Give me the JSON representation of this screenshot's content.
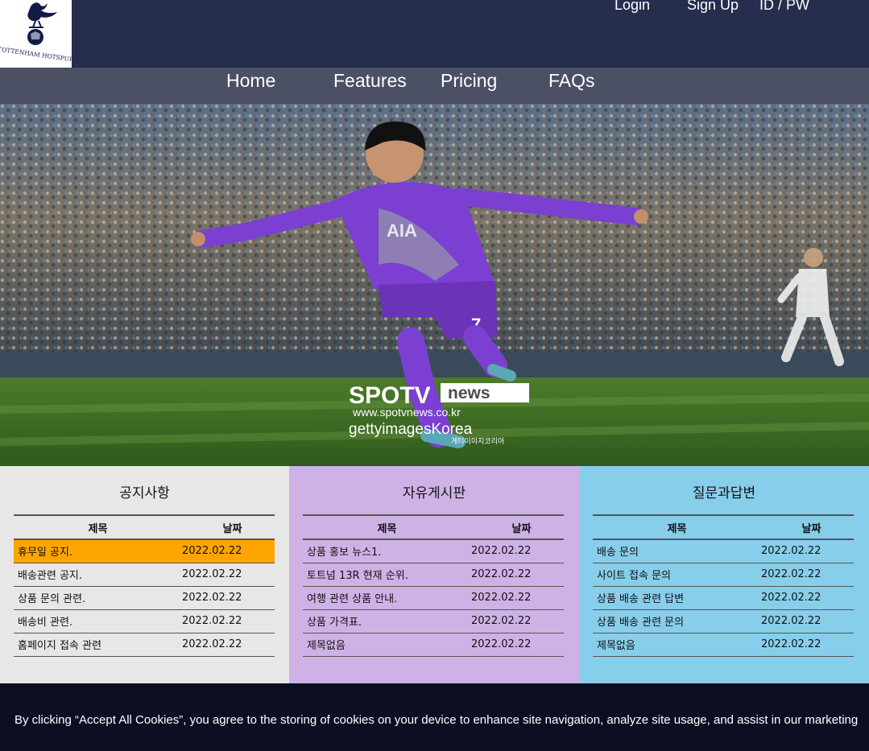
{
  "header": {
    "logo_text": "TOTTENHAM HOTSPUR",
    "auth_links": [
      "Login",
      "Sign Up",
      "ID / PW"
    ]
  },
  "nav": {
    "items": [
      "Home",
      "Features",
      "Pricing",
      "FAQs"
    ]
  },
  "hero": {
    "watermark_brand": "SPOTV",
    "watermark_badge": "news",
    "watermark_url": "www.spotvnews.co.kr",
    "watermark_getty": "gettyimagesKorea",
    "watermark_getty_kr": "게티이미지코리아",
    "shirt_sponsor": "AIA",
    "shirt_number": "7"
  },
  "boards": [
    {
      "title": "공지사항",
      "col_title": "제목",
      "col_date": "날짜",
      "rows": [
        {
          "title": "휴무일 공지.",
          "date": "2022.02.22",
          "highlight": true
        },
        {
          "title": "배송관련 공지.",
          "date": "2022.02.22"
        },
        {
          "title": "상품 문의 관련.",
          "date": "2022.02.22"
        },
        {
          "title": "배송비 관련.",
          "date": "2022.02.22"
        },
        {
          "title": "홈페이지 접속 관련",
          "date": "2022.02.22"
        }
      ]
    },
    {
      "title": "자유게시판",
      "col_title": "제목",
      "col_date": "날짜",
      "rows": [
        {
          "title": "상품 홍보 뉴스1.",
          "date": "2022.02.22"
        },
        {
          "title": "토트넘 13R 현재 순위.",
          "date": "2022.02.22"
        },
        {
          "title": "여행 관련 상품 안내.",
          "date": "2022.02.22"
        },
        {
          "title": "상품 가격표.",
          "date": "2022.02.22"
        },
        {
          "title": "제목없음",
          "date": "2022.02.22"
        }
      ]
    },
    {
      "title": "질문과답변",
      "col_title": "제목",
      "col_date": "날짜",
      "rows": [
        {
          "title": "배송 문의",
          "date": "2022.02.22"
        },
        {
          "title": "사이트 접속 문의",
          "date": "2022.02.22"
        },
        {
          "title": "상품 배송 관련 답변",
          "date": "2022.02.22"
        },
        {
          "title": "상품 배송 관련 문의",
          "date": "2022.02.22"
        },
        {
          "title": "제목없음",
          "date": "2022.02.22"
        }
      ]
    }
  ],
  "cookie": {
    "text": "By clicking “Accept All Cookies”, you agree to the storing of cookies on your device to enhance site navigation, analyze site usage, and assist in our marketing"
  },
  "colors": {
    "header_bg": "#262d4d",
    "nav_bg": "#4b5065",
    "board1_bg": "#e7e7e7",
    "board2_bg": "#ceb2e6",
    "board3_bg": "#87ceeb",
    "highlight": "#ffa500",
    "cookie_bg": "#0c0f22"
  }
}
